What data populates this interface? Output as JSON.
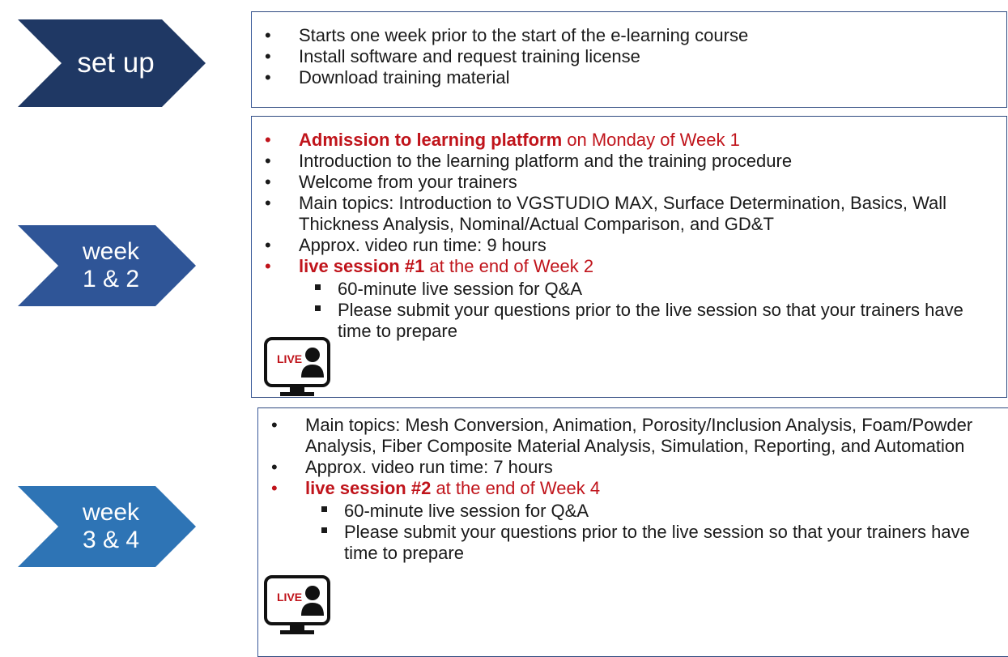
{
  "phases": [
    {
      "label": "set up",
      "color": "#1f3864",
      "items": [
        "Starts one week prior to the start of the e-learning course",
        "Install software and request training license",
        "Download training material"
      ]
    },
    {
      "label_line1": "week",
      "label_line2": "1 & 2",
      "color": "#2f5597",
      "admission_bold": "Admission to learning platform",
      "admission_rest": " on Monday of Week 1",
      "items": [
        "Introduction to the learning platform and the training procedure",
        "Welcome from your trainers",
        "Main topics: Introduction to VGSTUDIO MAX, Surface Determination, Basics, Wall Thickness Analysis, Nominal/Actual Comparison, and GD&T",
        "Approx. video run time: 9 hours"
      ],
      "live_bold": "live session #1",
      "live_rest": " at the end of Week 2",
      "live_icon_text": "LIVE",
      "sub_items": [
        "60-minute live session for Q&A",
        "Please submit your questions prior to the live session so that your trainers have time to prepare"
      ]
    },
    {
      "label_line1": "week",
      "label_line2": "3 & 4",
      "color": "#2e74b5",
      "items": [
        "Main topics: Mesh Conversion, Animation, Porosity/Inclusion Analysis, Foam/Powder Analysis, Fiber Composite Material Analysis, Simulation, Reporting, and Automation",
        "Approx. video run time: 7 hours"
      ],
      "live_bold": "live session #2",
      "live_rest": " at the end of Week 4",
      "live_icon_text": "LIVE",
      "sub_items": [
        "60-minute live session for Q&A",
        "Please submit your questions prior to the live session so that your trainers have time to prepare"
      ]
    }
  ],
  "icons": {
    "live": "monitor-person-icon"
  }
}
